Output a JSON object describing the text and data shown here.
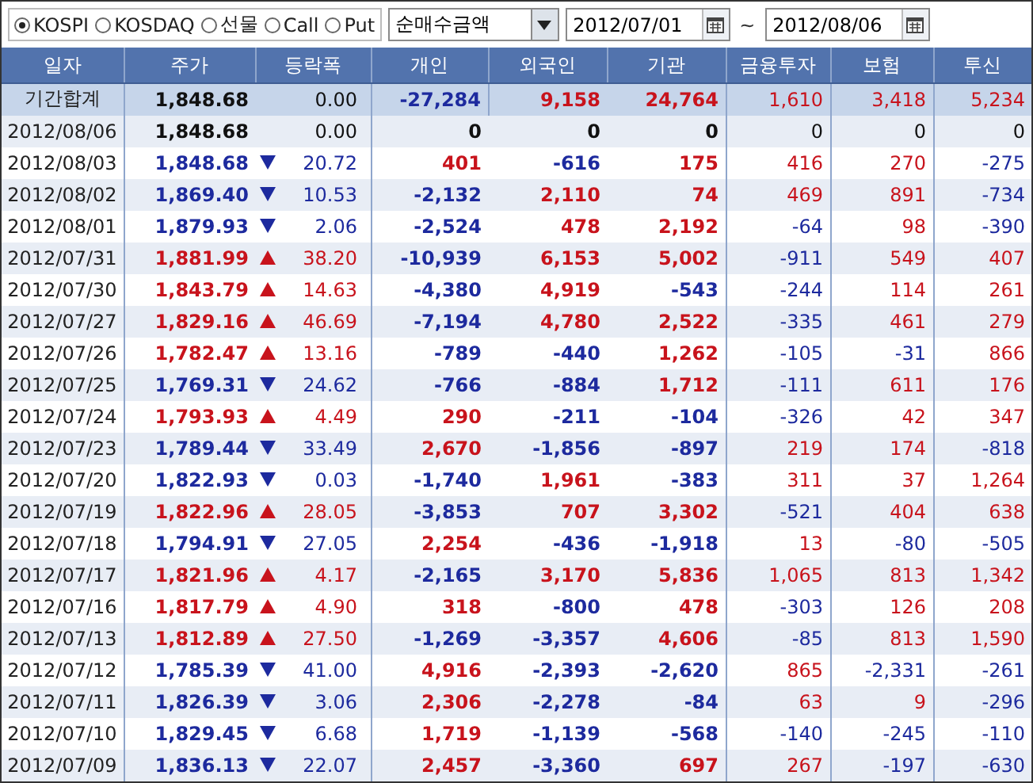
{
  "filters": {
    "markets": [
      {
        "label": "KOSPI",
        "selected": true
      },
      {
        "label": "KOSDAQ",
        "selected": false
      },
      {
        "label": "선물",
        "selected": false
      },
      {
        "label": "Call",
        "selected": false
      },
      {
        "label": "Put",
        "selected": false
      }
    ],
    "measure": {
      "value": "순매수금액"
    },
    "date_from": "2012/07/01",
    "separator": "~",
    "date_to": "2012/08/06"
  },
  "table": {
    "columns": [
      "일자",
      "주가",
      "등락폭",
      "개인",
      "외국인",
      "기관",
      "금융투자",
      "보험",
      "투신"
    ],
    "rows": [
      {
        "kind": "total",
        "date": "기간합계",
        "price": "1,848.68",
        "rose": false,
        "fell": false,
        "change": "0.00",
        "values": [
          "-27,284",
          "9,158",
          "24,764",
          "1,610",
          "3,418",
          "5,234"
        ]
      },
      {
        "kind": "day",
        "date": "2012/08/06",
        "price": "1,848.68",
        "rose": false,
        "fell": false,
        "change": "0.00",
        "values": [
          "0",
          "0",
          "0",
          "0",
          "0",
          "0"
        ]
      },
      {
        "kind": "day",
        "date": "2012/08/03",
        "price": "1,848.68",
        "rose": false,
        "fell": true,
        "change": "20.72",
        "values": [
          "401",
          "-616",
          "175",
          "416",
          "270",
          "-275"
        ]
      },
      {
        "kind": "day",
        "date": "2012/08/02",
        "price": "1,869.40",
        "rose": false,
        "fell": true,
        "change": "10.53",
        "values": [
          "-2,132",
          "2,110",
          "74",
          "469",
          "891",
          "-734"
        ]
      },
      {
        "kind": "day",
        "date": "2012/08/01",
        "price": "1,879.93",
        "rose": false,
        "fell": true,
        "change": "2.06",
        "values": [
          "-2,524",
          "478",
          "2,192",
          "-64",
          "98",
          "-390"
        ]
      },
      {
        "kind": "day",
        "date": "2012/07/31",
        "price": "1,881.99",
        "rose": true,
        "fell": false,
        "change": "38.20",
        "values": [
          "-10,939",
          "6,153",
          "5,002",
          "-911",
          "549",
          "407"
        ]
      },
      {
        "kind": "day",
        "date": "2012/07/30",
        "price": "1,843.79",
        "rose": true,
        "fell": false,
        "change": "14.63",
        "values": [
          "-4,380",
          "4,919",
          "-543",
          "-244",
          "114",
          "261"
        ]
      },
      {
        "kind": "day",
        "date": "2012/07/27",
        "price": "1,829.16",
        "rose": true,
        "fell": false,
        "change": "46.69",
        "values": [
          "-7,194",
          "4,780",
          "2,522",
          "-335",
          "461",
          "279"
        ]
      },
      {
        "kind": "day",
        "date": "2012/07/26",
        "price": "1,782.47",
        "rose": true,
        "fell": false,
        "change": "13.16",
        "values": [
          "-789",
          "-440",
          "1,262",
          "-105",
          "-31",
          "866"
        ]
      },
      {
        "kind": "day",
        "date": "2012/07/25",
        "price": "1,769.31",
        "rose": false,
        "fell": true,
        "change": "24.62",
        "values": [
          "-766",
          "-884",
          "1,712",
          "-111",
          "611",
          "176"
        ]
      },
      {
        "kind": "day",
        "date": "2012/07/24",
        "price": "1,793.93",
        "rose": true,
        "fell": false,
        "change": "4.49",
        "values": [
          "290",
          "-211",
          "-104",
          "-326",
          "42",
          "347"
        ]
      },
      {
        "kind": "day",
        "date": "2012/07/23",
        "price": "1,789.44",
        "rose": false,
        "fell": true,
        "change": "33.49",
        "values": [
          "2,670",
          "-1,856",
          "-897",
          "219",
          "174",
          "-818"
        ]
      },
      {
        "kind": "day",
        "date": "2012/07/20",
        "price": "1,822.93",
        "rose": false,
        "fell": true,
        "change": "0.03",
        "values": [
          "-1,740",
          "1,961",
          "-383",
          "311",
          "37",
          "1,264"
        ]
      },
      {
        "kind": "day",
        "date": "2012/07/19",
        "price": "1,822.96",
        "rose": true,
        "fell": false,
        "change": "28.05",
        "values": [
          "-3,853",
          "707",
          "3,302",
          "-521",
          "404",
          "638"
        ]
      },
      {
        "kind": "day",
        "date": "2012/07/18",
        "price": "1,794.91",
        "rose": false,
        "fell": true,
        "change": "27.05",
        "values": [
          "2,254",
          "-436",
          "-1,918",
          "13",
          "-80",
          "-505"
        ]
      },
      {
        "kind": "day",
        "date": "2012/07/17",
        "price": "1,821.96",
        "rose": true,
        "fell": false,
        "change": "4.17",
        "values": [
          "-2,165",
          "3,170",
          "5,836",
          "1,065",
          "813",
          "1,342"
        ]
      },
      {
        "kind": "day",
        "date": "2012/07/16",
        "price": "1,817.79",
        "rose": true,
        "fell": false,
        "change": "4.90",
        "values": [
          "318",
          "-800",
          "478",
          "-303",
          "126",
          "208"
        ]
      },
      {
        "kind": "day",
        "date": "2012/07/13",
        "price": "1,812.89",
        "rose": true,
        "fell": false,
        "change": "27.50",
        "values": [
          "-1,269",
          "-3,357",
          "4,606",
          "-85",
          "813",
          "1,590"
        ]
      },
      {
        "kind": "day",
        "date": "2012/07/12",
        "price": "1,785.39",
        "rose": false,
        "fell": true,
        "change": "41.00",
        "values": [
          "4,916",
          "-2,393",
          "-2,620",
          "865",
          "-2,331",
          "-261"
        ]
      },
      {
        "kind": "day",
        "date": "2012/07/11",
        "price": "1,826.39",
        "rose": false,
        "fell": true,
        "change": "3.06",
        "values": [
          "2,306",
          "-2,278",
          "-84",
          "63",
          "9",
          "-296"
        ]
      },
      {
        "kind": "day",
        "date": "2012/07/10",
        "price": "1,829.45",
        "rose": false,
        "fell": true,
        "change": "6.68",
        "values": [
          "1,719",
          "-1,139",
          "-568",
          "-140",
          "-245",
          "-110"
        ]
      },
      {
        "kind": "day",
        "date": "2012/07/09",
        "price": "1,836.13",
        "rose": false,
        "fell": true,
        "change": "22.07",
        "values": [
          "2,457",
          "-3,360",
          "697",
          "267",
          "-197",
          "-630"
        ]
      }
    ]
  }
}
